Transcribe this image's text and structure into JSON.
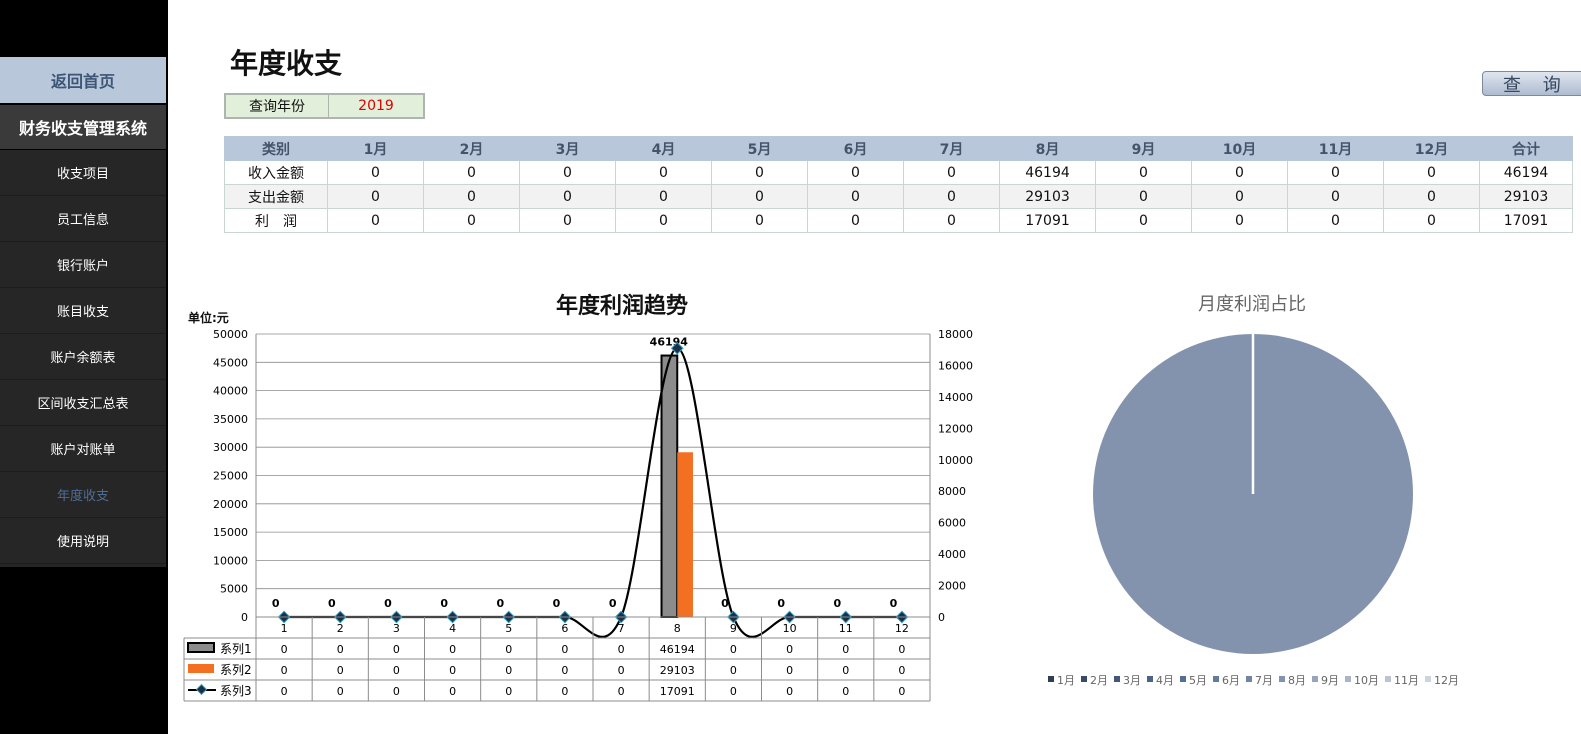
{
  "sidebar": {
    "home": "返回首页",
    "system": "财务收支管理系统",
    "items": [
      {
        "label": "收支项目"
      },
      {
        "label": "员工信息"
      },
      {
        "label": "银行账户"
      },
      {
        "label": "账目收支"
      },
      {
        "label": "账户余额表"
      },
      {
        "label": "区间收支汇总表"
      },
      {
        "label": "账户对账单"
      },
      {
        "label": "年度收支"
      },
      {
        "label": "使用说明"
      }
    ]
  },
  "page": {
    "title": "年度收支",
    "year_label": "查询年份",
    "year_value": "2019",
    "query_button": "查 询"
  },
  "summary": {
    "headers": [
      "类别",
      "1月",
      "2月",
      "3月",
      "4月",
      "5月",
      "6月",
      "7月",
      "8月",
      "9月",
      "10月",
      "11月",
      "12月",
      "合计"
    ],
    "rows": [
      [
        "收入金额",
        "0",
        "0",
        "0",
        "0",
        "0",
        "0",
        "0",
        "46194",
        "0",
        "0",
        "0",
        "0",
        "46194"
      ],
      [
        "支出金额",
        "0",
        "0",
        "0",
        "0",
        "0",
        "0",
        "0",
        "29103",
        "0",
        "0",
        "0",
        "0",
        "29103"
      ],
      [
        "利　润",
        "0",
        "0",
        "0",
        "0",
        "0",
        "0",
        "0",
        "17091",
        "0",
        "0",
        "0",
        "0",
        "17091"
      ]
    ]
  },
  "chart_data": [
    {
      "type": "bar",
      "title": "年度利润趋势",
      "unit_label": "单位:元",
      "categories": [
        "1",
        "2",
        "3",
        "4",
        "5",
        "6",
        "7",
        "8",
        "9",
        "10",
        "11",
        "12"
      ],
      "series": [
        {
          "name": "系列1",
          "type": "bar",
          "axis": "left",
          "color": "#8c8c8c",
          "values": [
            0,
            0,
            0,
            0,
            0,
            0,
            0,
            46194,
            0,
            0,
            0,
            0
          ]
        },
        {
          "name": "系列2",
          "type": "bar",
          "axis": "left",
          "color": "#f36f21",
          "values": [
            0,
            0,
            0,
            0,
            0,
            0,
            0,
            29103,
            0,
            0,
            0,
            0
          ]
        },
        {
          "name": "系列3",
          "type": "line",
          "axis": "right",
          "color": "#000000",
          "values": [
            0,
            0,
            0,
            0,
            0,
            0,
            0,
            17091,
            0,
            0,
            0,
            0
          ]
        }
      ],
      "bar_data_labels": [
        "0",
        "0",
        "0",
        "0",
        "0",
        "0",
        "0",
        "46194",
        "0",
        "0",
        "0",
        "0"
      ],
      "ylim_left": [
        0,
        50000
      ],
      "yticks_left": [
        "0",
        "5000",
        "10000",
        "15000",
        "20000",
        "25000",
        "30000",
        "35000",
        "40000",
        "45000",
        "50000"
      ],
      "ylim_right": [
        0,
        18000
      ],
      "yticks_right": [
        "0",
        "2000",
        "4000",
        "6000",
        "8000",
        "10000",
        "12000",
        "14000",
        "16000",
        "18000"
      ],
      "grid": true,
      "legend": "data-table"
    },
    {
      "type": "pie",
      "title": "月度利润占比",
      "categories": [
        "1月",
        "2月",
        "3月",
        "4月",
        "5月",
        "6月",
        "7月",
        "8月",
        "9月",
        "10月",
        "11月",
        "12月"
      ],
      "values": [
        0,
        0,
        0,
        0,
        0,
        0,
        0,
        17091,
        0,
        0,
        0,
        0
      ],
      "colors": [
        "#2f3e55",
        "#394b66",
        "#42577a",
        "#4b6388",
        "#556f94",
        "#637b9d",
        "#7184a5",
        "#8393ae",
        "#96a4bc",
        "#a9b4c8",
        "#bcc4d4",
        "#ced4df"
      ],
      "legend": "bottom"
    }
  ]
}
